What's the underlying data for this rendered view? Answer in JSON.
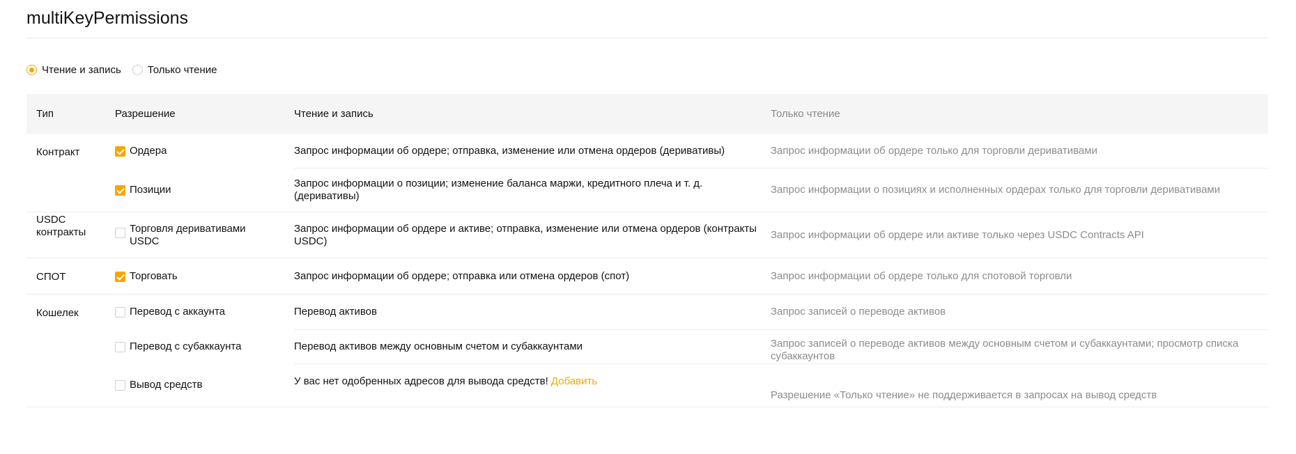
{
  "title": "multiKeyPermissions",
  "mode": {
    "options": [
      {
        "label": "Чтение и запись",
        "selected": true
      },
      {
        "label": "Только чтение",
        "selected": false
      }
    ]
  },
  "headers": {
    "type": "Тип",
    "permission": "Разрешение",
    "read_write": "Чтение и запись",
    "read_only": "Только чтение"
  },
  "groups": [
    {
      "type": "Контракт",
      "rows": [
        {
          "permission": "Ордера",
          "checked": true,
          "read_write": "Запрос информации об ордере; отправка, изменение или отмена ордеров (деривативы)",
          "read_only": "Запрос информации об ордере только для торговли деривативами"
        },
        {
          "permission": "Позиции",
          "checked": true,
          "read_write": "Запрос информации о позиции; изменение баланса маржи, кредитного плеча и т. д. (деривативы)",
          "read_only": "Запрос информации о позициях и исполненных ордерах только для торговли деривативами"
        }
      ]
    },
    {
      "type": "USDC контракты",
      "rows": [
        {
          "permission": "Торговля деривативами USDC",
          "checked": false,
          "read_write": "Запрос информации об ордере и активе; отправка, изменение или отмена ордеров (контракты USDC)",
          "read_only": "Запрос информации об ордере или активе только через USDC Contracts API"
        }
      ]
    },
    {
      "type": "СПОТ",
      "rows": [
        {
          "permission": "Торговать",
          "checked": true,
          "read_write": "Запрос информации об ордере; отправка или отмена ордеров (спот)",
          "read_only": "Запрос информации об ордере только для спотовой торговли"
        }
      ]
    },
    {
      "type": "Кошелек",
      "rows": [
        {
          "permission": "Перевод с аккаунта",
          "checked": false,
          "read_write": "Перевод активов",
          "read_only": "Запрос записей о переводе активов"
        },
        {
          "permission": "Перевод с субаккаунта",
          "checked": false,
          "read_write": "Перевод активов между основным счетом и субаккаунтами",
          "read_only": "Запрос записей о переводе активов между основным счетом и субаккаунтами; просмотр списка субаккаунтов"
        },
        {
          "permission": "Вывод средств",
          "checked": false,
          "read_write": "У вас нет одобренных адресов для вывода средств!",
          "read_write_link": "Добавить",
          "read_only": "Разрешение «Только чтение» не поддерживается в запросах на вывод средств"
        }
      ]
    }
  ],
  "colors": {
    "accent": "#f7a600",
    "header_bg": "#f5f5f5",
    "muted_text": "#8c8c8c"
  }
}
